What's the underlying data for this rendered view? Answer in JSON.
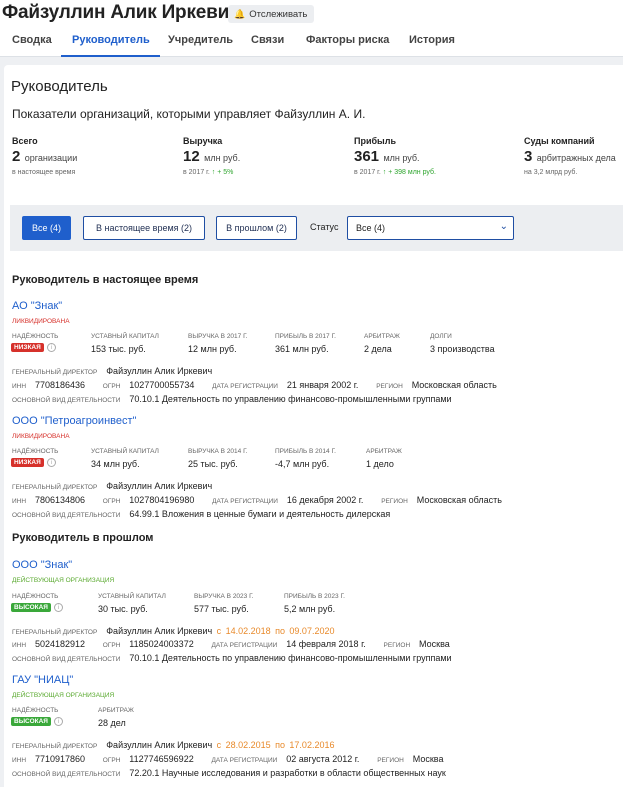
{
  "header": {
    "title": "Файзуллин Алик Иркевич",
    "track_label": "Отслеживать",
    "tabs": [
      "Сводка",
      "Руководитель",
      "Учредитель",
      "Связи",
      "Факторы риска",
      "История"
    ]
  },
  "section": {
    "title": "Руководитель",
    "subtitle": "Показатели организаций, которыми управляет Файзуллин А. И."
  },
  "stats": [
    {
      "label": "Всего",
      "value": "2",
      "unit": "организации",
      "sub": "в настоящее время",
      "delta": ""
    },
    {
      "label": "Выручка",
      "value": "12",
      "unit": "млн руб.",
      "sub": "в 2017 г.",
      "delta": "↑ + 5%"
    },
    {
      "label": "Прибыль",
      "value": "361",
      "unit": "млн руб.",
      "sub": "в 2017 г.",
      "delta": "↑ + 398 млн руб."
    },
    {
      "label": "Суды компаний",
      "value": "3",
      "unit": "арбитражных дела",
      "sub": "на 3,2 млрд руб.",
      "delta": ""
    }
  ],
  "filters": {
    "buttons": [
      "Все (4)",
      "В настоящее время (2)",
      "В прошлом (2)"
    ],
    "status_label": "Статус",
    "status_value": "Все (4)"
  },
  "groups": {
    "current_title": "Руководитель в настоящее время",
    "past_title": "Руководитель в прошлом"
  },
  "labels": {
    "reliability": "НАДЁЖНОСТЬ",
    "capital": "УСТАВНЫЙ КАПИТАЛ",
    "arbitrage": "АРБИТРАЖ",
    "debts": "ДОЛГИ",
    "director": "ГЕНЕРАЛЬНЫЙ ДИРЕКТОР",
    "inn": "ИНН",
    "ogrn": "ОГРН",
    "reg_date": "ДАТА РЕГИСТРАЦИИ",
    "region": "РЕГИОН",
    "activity": "ОСНОВНОЙ ВИД ДЕЯТЕЛЬНОСТИ",
    "date_from": "с",
    "date_to": "по"
  },
  "companies": [
    {
      "name": "АО \"Знак\"",
      "status": "ЛИКВИДИРОВАНА",
      "reliability": "НИЗКАЯ",
      "capital": "153 тыс. руб.",
      "revenue_label": "ВЫРУЧКА В 2017 Г.",
      "revenue": "12 млн руб.",
      "profit_label": "ПРИБЫЛЬ В 2017 Г.",
      "profit": "361 млн руб.",
      "arbitrage": "2 дела",
      "debts": "3 производства",
      "director": "Файзуллин Алик Иркевич",
      "inn": "7708186436",
      "ogrn": "1027700055734",
      "reg_date": "21 января 2002 г.",
      "region": "Московская область",
      "activity": "70.10.1 Деятельность по управлению финансово-промышленными группами"
    },
    {
      "name": "ООО \"Петроагроинвест\"",
      "status": "ЛИКВИДИРОВАНА",
      "reliability": "НИЗКАЯ",
      "capital": "34 млн руб.",
      "revenue_label": "ВЫРУЧКА В 2014 Г.",
      "revenue": "25 тыс. руб.",
      "profit_label": "ПРИБЫЛЬ В 2014 Г.",
      "profit": "-4,7 млн руб.",
      "arbitrage": "1 дело",
      "director": "Файзуллин Алик Иркевич",
      "inn": "7806134806",
      "ogrn": "1027804196980",
      "reg_date": "16 декабря 2002 г.",
      "region": "Московская область",
      "activity": "64.99.1 Вложения в ценные бумаги и деятельность дилерская"
    },
    {
      "name": "ООО \"Знак\"",
      "status": "ДЕЙСТВУЮЩАЯ ОРГАНИЗАЦИЯ",
      "reliability": "ВЫСОКАЯ",
      "capital": "30 тыс. руб.",
      "revenue_label": "ВЫРУЧКА В 2023 Г.",
      "revenue": "577 тыс. руб.",
      "profit_label": "ПРИБЫЛЬ В 2023 Г.",
      "profit": "5,2 млн руб.",
      "director": "Файзуллин Алик Иркевич",
      "date_from": "14.02.2018",
      "date_to": "09.07.2020",
      "inn": "5024182912",
      "ogrn": "1185024003372",
      "reg_date": "14 февраля 2018 г.",
      "region": "Москва",
      "activity": "70.10.1 Деятельность по управлению финансово-промышленными группами"
    },
    {
      "name": "ГАУ \"НИАЦ\"",
      "status": "ДЕЙСТВУЮЩАЯ ОРГАНИЗАЦИЯ",
      "reliability": "ВЫСОКАЯ",
      "arbitrage": "28 дел",
      "director": "Файзуллин Алик Иркевич",
      "date_from": "28.02.2015",
      "date_to": "17.02.2016",
      "inn": "7710917860",
      "ogrn": "1127746596922",
      "reg_date": "02 августа 2012 г.",
      "region": "Москва",
      "activity": "72.20.1 Научные исследования и разработки в области общественных наук"
    }
  ],
  "colors": {
    "accent": "#1f5fcc",
    "danger": "#d6312b",
    "success": "#3aa83a",
    "period": "#e88a2b"
  }
}
